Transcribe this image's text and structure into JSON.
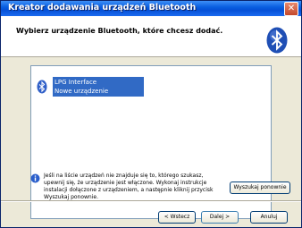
{
  "window": {
    "title": "Kreator dodawania urządzeń Bluetooth",
    "close_symbol": "✕"
  },
  "header": {
    "heading": "Wybierz urządzenie Bluetooth, które chcesz dodać.",
    "logo_icon": "bluetooth-icon"
  },
  "device_list": {
    "items": [
      {
        "name": "LPG Interface",
        "status": "Nowe urządzenie",
        "icon": "bluetooth-device-icon"
      }
    ]
  },
  "info": {
    "icon": "info-icon",
    "text": "Jeśli na liście urządzeń nie znajduje się to, którego szukasz, upewnij się, że urządzenie jest włączone. Wykonaj instrukcje instalacji dołączone z urządzeniem, a następnie kliknij przycisk Wyszukaj ponownie."
  },
  "buttons": {
    "rescan": "Wyszukaj ponownie",
    "back": "< Wstecz",
    "next": "Dalej >",
    "cancel": "Anuluj"
  },
  "colors": {
    "title_bar": "#0a5fe0",
    "selection": "#316ac5",
    "dialog_bg": "#ece9d8"
  }
}
